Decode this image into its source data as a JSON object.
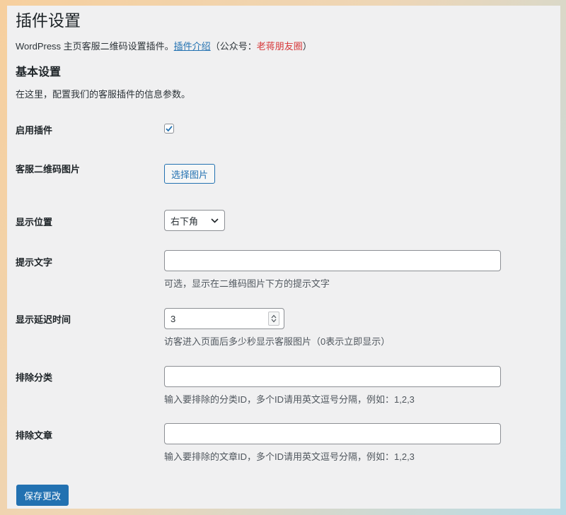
{
  "page": {
    "title": "插件设置",
    "intro_text": "WordPress 主页客服二维码设置插件。",
    "intro_link": "插件介绍",
    "intro_paren_open": "（公众号：",
    "intro_highlight": "老蒋朋友圈",
    "intro_paren_close": "）"
  },
  "section": {
    "title": "基本设置",
    "description": "在这里，配置我们的客服插件的信息参数。"
  },
  "fields": {
    "enable": {
      "label": "启用插件",
      "checked": true
    },
    "qr_image": {
      "label": "客服二维码图片",
      "button_label": "选择图片"
    },
    "position": {
      "label": "显示位置",
      "value": "右下角"
    },
    "tip_text": {
      "label": "提示文字",
      "value": "",
      "help": "可选，显示在二维码图片下方的提示文字"
    },
    "delay": {
      "label": "显示延迟时间",
      "value": "3",
      "help": "访客进入页面后多少秒显示客服图片（0表示立即显示）"
    },
    "exclude_categories": {
      "label": "排除分类",
      "value": "",
      "help": "输入要排除的分类ID，多个ID请用英文逗号分隔，例如：1,2,3"
    },
    "exclude_posts": {
      "label": "排除文章",
      "value": "",
      "help": "输入要排除的文章ID，多个ID请用英文逗号分隔，例如：1,2,3"
    }
  },
  "actions": {
    "save_label": "保存更改"
  },
  "colors": {
    "primary": "#2271b1",
    "highlight": "#d63638",
    "background": "#f0f0f1"
  }
}
